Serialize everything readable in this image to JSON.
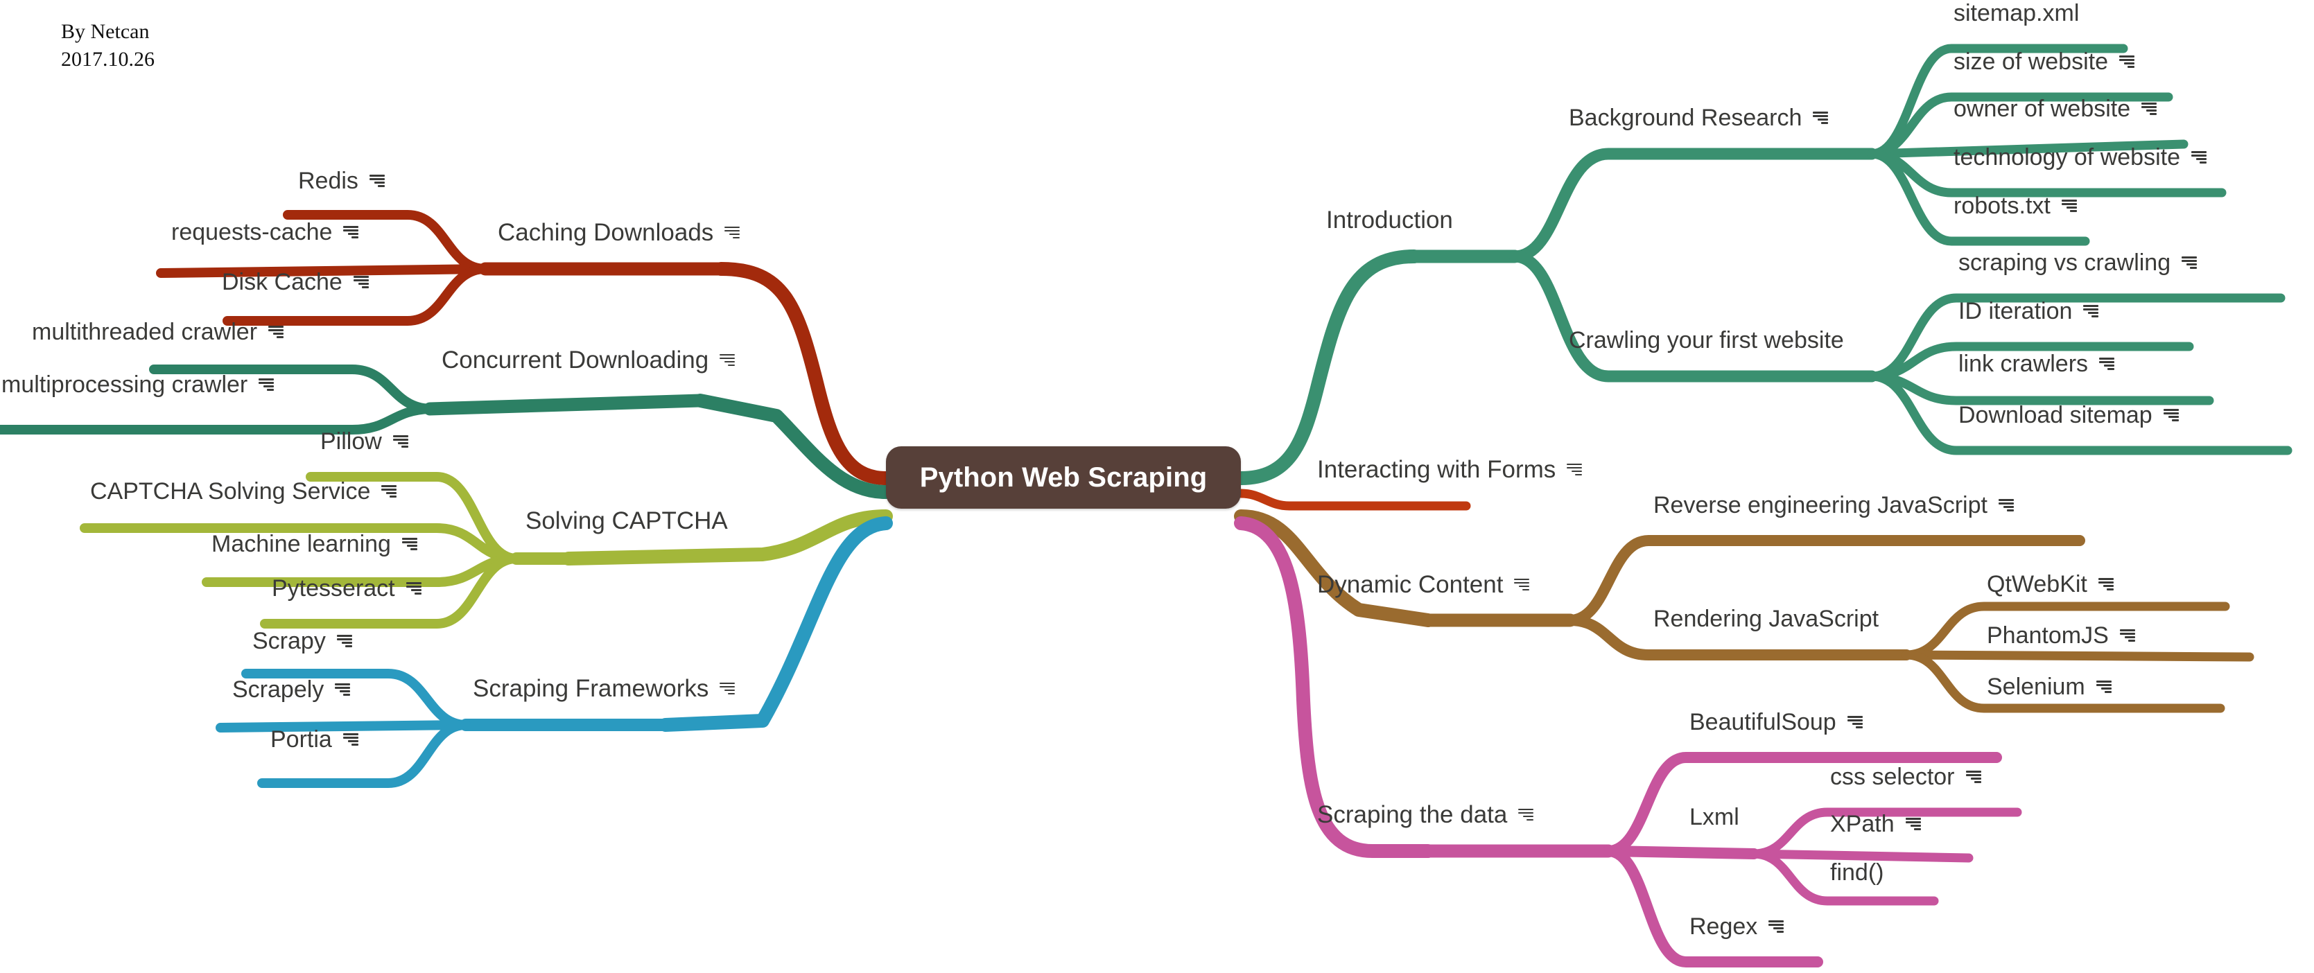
{
  "byline": {
    "author": "By Netcan",
    "date": "2017.10.26"
  },
  "root": {
    "label": "Python Web Scraping",
    "color": "#574039"
  },
  "icons": {
    "note": "note-icon"
  },
  "palette": {
    "teal": "#3a9070",
    "dark_red": "#a32a0c",
    "olive": "#a3b73a",
    "blue": "#2a9ac0",
    "brown": "#9a6b2f",
    "magenta": "#c7549d",
    "text": "#3a3a38",
    "background": "#ffffff"
  },
  "branches": [
    {
      "id": "introduction",
      "side": "right",
      "color": "#3a9070",
      "label": "Introduction",
      "has_note": false,
      "children": [
        {
          "label": "Background Research",
          "has_note": true,
          "children": [
            {
              "label": "sitemap.xml",
              "has_note": false
            },
            {
              "label": "size of website",
              "has_note": true
            },
            {
              "label": "owner of website",
              "has_note": true
            },
            {
              "label": "technology of website",
              "has_note": true
            },
            {
              "label": "robots.txt",
              "has_note": true
            }
          ]
        },
        {
          "label": "Crawling your first website",
          "has_note": false,
          "children": [
            {
              "label": "scraping vs crawling",
              "has_note": true
            },
            {
              "label": "ID iteration",
              "has_note": true
            },
            {
              "label": "link crawlers",
              "has_note": true
            },
            {
              "label": "Download sitemap",
              "has_note": true
            }
          ]
        }
      ]
    },
    {
      "id": "interacting-with-forms",
      "side": "right",
      "color": "#c0390f",
      "label": "Interacting with Forms",
      "has_note": true,
      "children": []
    },
    {
      "id": "dynamic-content",
      "side": "right",
      "color": "#9a6b2f",
      "label": "Dynamic Content",
      "has_note": true,
      "children": [
        {
          "label": "Reverse engineering JavaScript",
          "has_note": true,
          "children": []
        },
        {
          "label": "Rendering JavaScript",
          "has_note": false,
          "children": [
            {
              "label": "QtWebKit",
              "has_note": true
            },
            {
              "label": "PhantomJS",
              "has_note": true
            },
            {
              "label": "Selenium",
              "has_note": true
            }
          ]
        }
      ]
    },
    {
      "id": "scraping-the-data",
      "side": "right",
      "color": "#c7549d",
      "label": "Scraping the data",
      "has_note": true,
      "children": [
        {
          "label": "BeautifulSoup",
          "has_note": true,
          "children": []
        },
        {
          "label": "Lxml",
          "has_note": false,
          "children": [
            {
              "label": "css selector",
              "has_note": true
            },
            {
              "label": "XPath",
              "has_note": true
            },
            {
              "label": "find()",
              "has_note": false
            }
          ]
        },
        {
          "label": "Regex",
          "has_note": true,
          "children": []
        }
      ]
    },
    {
      "id": "caching-downloads",
      "side": "left",
      "color": "#a32a0c",
      "label": "Caching Downloads",
      "has_note": true,
      "children": [
        {
          "label": "Redis",
          "has_note": true
        },
        {
          "label": "requests-cache",
          "has_note": true
        },
        {
          "label": "Disk Cache",
          "has_note": true
        }
      ]
    },
    {
      "id": "concurrent-downloading",
      "side": "left",
      "color": "#2c8064",
      "label": "Concurrent Downloading",
      "has_note": true,
      "children": [
        {
          "label": "multithreaded crawler",
          "has_note": true
        },
        {
          "label": "multiprocessing crawler",
          "has_note": true
        }
      ]
    },
    {
      "id": "solving-captcha",
      "side": "left",
      "color": "#a3b73a",
      "label": "Solving CAPTCHA",
      "has_note": false,
      "children": [
        {
          "label": "Pillow",
          "has_note": true
        },
        {
          "label": "CAPTCHA Solving Service",
          "has_note": true
        },
        {
          "label": "Machine learning",
          "has_note": true
        },
        {
          "label": "Pytesseract",
          "has_note": true
        }
      ]
    },
    {
      "id": "scraping-frameworks",
      "side": "left",
      "color": "#2a9ac0",
      "label": "Scraping Frameworks",
      "has_note": true,
      "children": [
        {
          "label": "Scrapy",
          "has_note": true
        },
        {
          "label": "Scrapely",
          "has_note": true
        },
        {
          "label": "Portia",
          "has_note": true
        }
      ]
    }
  ]
}
